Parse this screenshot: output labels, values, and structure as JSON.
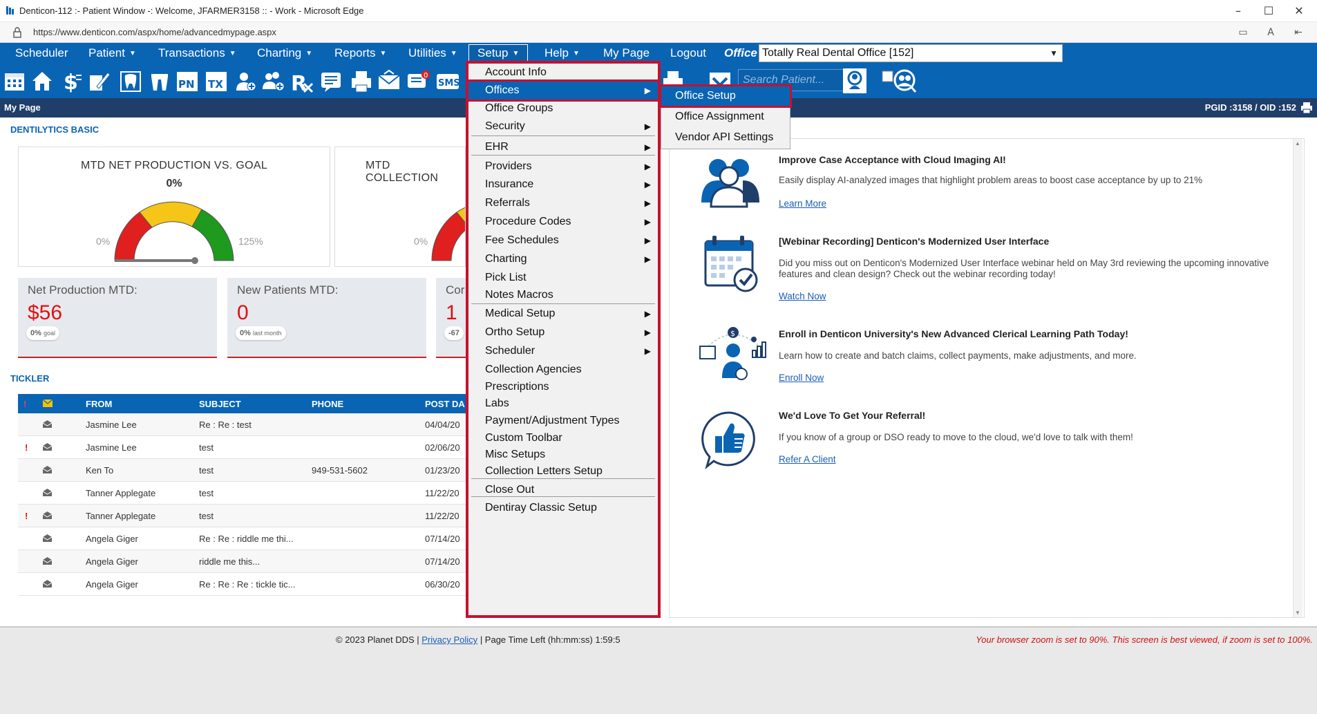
{
  "window": {
    "title": "Denticon-112 :- Patient Window -: Welcome, JFARMER3158 :: - Work - Microsoft Edge",
    "url": "https://www.denticon.com/aspx/home/advancedmypage.aspx"
  },
  "nav": {
    "items": [
      "Scheduler",
      "Patient",
      "Transactions",
      "Charting",
      "Reports",
      "Utilities",
      "Setup",
      "Help",
      "My Page",
      "Logout"
    ],
    "office_label": "Office",
    "office_value": "Totally Real Dental Office [152]"
  },
  "toolbar": {
    "search_placeholder": "Search Patient...",
    "icons": [
      "calendar-icon",
      "home-icon",
      "dollar-icon",
      "pencil-icon",
      "tooth-icon",
      "teeth-icon",
      "pn-icon",
      "tx-icon",
      "add-user-icon",
      "add-users-icon",
      "rx-icon",
      "notes-icon",
      "printer-icon",
      "mail-icon",
      "chat-icon",
      "sms-icon"
    ],
    "labels": {
      "pn": "PN",
      "tx": "TX",
      "sms": "SMS",
      "badge": "0"
    }
  },
  "mypage_bar": {
    "title": "My Page",
    "ids": "PGID :3158  /  OID :152"
  },
  "dentilytics": {
    "section_title": "DENTILYTICS BASIC",
    "gauges": [
      {
        "title": "MTD NET PRODUCTION VS. GOAL",
        "percent": "0%",
        "min_label": "0%",
        "max_label": "125%"
      },
      {
        "title": "MTD COLLECTION",
        "min_label": "0%"
      }
    ],
    "stats": [
      {
        "label": "Net Production MTD:",
        "value": "$56",
        "badge_value": "0%",
        "badge_suffix": "goal"
      },
      {
        "label": "New Patients MTD:",
        "value": "0",
        "badge_value": "0%",
        "badge_suffix": "last month"
      },
      {
        "label": "Cor",
        "value": "1",
        "badge_value": "-67"
      }
    ]
  },
  "tickler": {
    "section_title": "TICKLER",
    "columns": [
      "FROM",
      "SUBJECT",
      "PHONE",
      "POST DA"
    ],
    "rows": [
      {
        "flag": "",
        "from": "Jasmine Lee",
        "subject": "Re : Re : test",
        "phone": "",
        "date": "04/04/20"
      },
      {
        "flag": "!",
        "from": "Jasmine Lee",
        "subject": "test",
        "phone": "",
        "date": "02/06/20"
      },
      {
        "flag": "",
        "from": "Ken To",
        "subject": "test",
        "phone": "949-531-5602",
        "date": "01/23/20"
      },
      {
        "flag": "",
        "from": "Tanner Applegate",
        "subject": "test",
        "phone": "",
        "date": "11/22/20"
      },
      {
        "flag": "!",
        "from": "Tanner Applegate",
        "subject": "test",
        "phone": "",
        "date": "11/22/20"
      },
      {
        "flag": "",
        "from": "Angela Giger",
        "subject": "Re : Re : riddle me thi...",
        "phone": "",
        "date": "07/14/20"
      },
      {
        "flag": "",
        "from": "Angela Giger",
        "subject": "riddle me this...",
        "phone": "",
        "date": "07/14/20"
      },
      {
        "flag": "",
        "from": "Angela Giger",
        "subject": "Re : Re : Re : tickle tic...",
        "phone": "",
        "date": "06/30/20"
      }
    ]
  },
  "promos": [
    {
      "title": "Improve Case Acceptance with Cloud Imaging AI!",
      "text": "Easily display AI-analyzed images that highlight problem areas to boost case acceptance by up to 21%",
      "link": "Learn More",
      "icon": "people-icon"
    },
    {
      "title": "[Webinar Recording] Denticon's Modernized User Interface",
      "text": "Did you miss out on Denticon's Modernized User Interface webinar held on May 3rd reviewing the upcoming innovative features and clean design? Check out the webinar recording today!",
      "link": "Watch Now",
      "icon": "calendar-check-icon"
    },
    {
      "title": "Enroll in Denticon University's New Advanced Clerical Learning Path Today!",
      "text": "Learn how to create and batch claims, collect payments, make adjustments, and more.",
      "link": "Enroll Now",
      "icon": "learning-path-icon"
    },
    {
      "title": "We'd Love To Get Your Referral!",
      "text": "If you know of a group or DSO ready to move to the cloud, we'd love to talk with them!",
      "link": "Refer A Client",
      "icon": "thumbs-up-icon"
    }
  ],
  "setup_menu": {
    "items": [
      {
        "label": "Account Info",
        "submenu": false
      },
      {
        "label": "Offices",
        "submenu": true
      },
      {
        "label": "Office Groups",
        "submenu": false
      },
      {
        "label": "Security",
        "submenu": true
      },
      {
        "label": "EHR",
        "submenu": true
      },
      {
        "label": "Providers",
        "submenu": true
      },
      {
        "label": "Insurance",
        "submenu": true
      },
      {
        "label": "Referrals",
        "submenu": true
      },
      {
        "label": "Procedure Codes",
        "submenu": true
      },
      {
        "label": "Fee Schedules",
        "submenu": true
      },
      {
        "label": "Charting",
        "submenu": true
      },
      {
        "label": "Pick List",
        "submenu": false
      },
      {
        "label": "Notes Macros",
        "submenu": false
      },
      {
        "label": "Medical Setup",
        "submenu": true
      },
      {
        "label": "Ortho Setup",
        "submenu": true
      },
      {
        "label": "Scheduler",
        "submenu": true
      },
      {
        "label": "Collection Agencies",
        "submenu": false
      },
      {
        "label": "Prescriptions",
        "submenu": false
      },
      {
        "label": "Labs",
        "submenu": false
      },
      {
        "label": "Payment/Adjustment Types",
        "submenu": false
      },
      {
        "label": "Custom Toolbar",
        "submenu": false
      },
      {
        "label": "Misc Setups",
        "submenu": false
      },
      {
        "label": "Collection Letters Setup",
        "submenu": false
      },
      {
        "label": "Close Out",
        "submenu": false
      },
      {
        "label": "Dentiray Classic Setup",
        "submenu": false
      }
    ]
  },
  "offices_submenu": {
    "items": [
      "Office Setup",
      "Office Assignment",
      "Vendor API Settings"
    ]
  },
  "footer": {
    "copyright": "© 2023 Planet DDS |",
    "privacy": "Privacy Policy",
    "page_time": "| Page Time Left (hh:mm:ss) 1:59:5",
    "zoom_warning": "Your browser zoom is set to 90%. This screen is best viewed, if zoom is set to 100%."
  },
  "colors": {
    "brand_blue": "#0a64b4",
    "dark_bar": "#1f3f6a",
    "highlight_red": "#c8102e",
    "stat_red": "#e01010"
  }
}
